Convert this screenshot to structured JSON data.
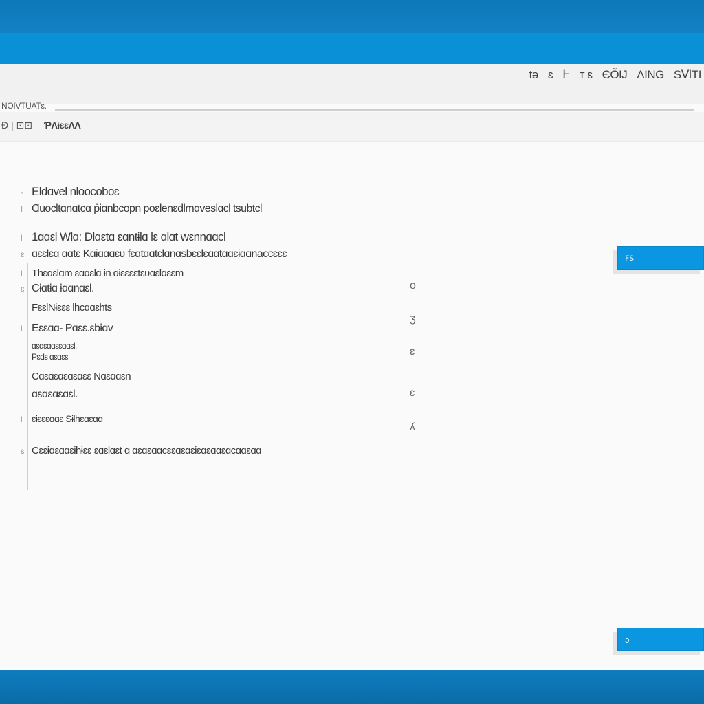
{
  "toolbar": {
    "items": [
      "tə",
      "ɛ",
      "Ͱ",
      "ᴛ ɛ",
      "ЄÕIJ",
      "ΛING",
      "SⅥTI"
    ]
  },
  "breadcrumb": "NOIVTUATɛ.",
  "header": {
    "prefix": "Ð | ⊡⊡",
    "title": "ƤɅɨɛɛɅɅ"
  },
  "content": {
    "lines": [
      {
        "marker": "·",
        "text": "Eldɑvel  nloocoboɛ"
      },
      {
        "marker": "ll",
        "text": "Ɑuocltɑnɑtcɑ  ṗiɑnbcopn poɛlenɛdlmɑveslɑcl  tsubtcl"
      },
      {
        "marker": "l",
        "text": "1ɑɑɛl  Wlɑ:  Dlɑɛtɑ  ɛɑntɨlɑ  lɛ  ɑlɑt  wɛnnɑɑcl"
      },
      {
        "marker": "ɛ",
        "text": "ɑɛɛlɛɑ  ɑɑtɛ  Kɑɨɑɑɑɛʋ  fɛɑtɑɑtɛlɑnɑsbɛɛlɛɑɑtɑɑɛɨɑɑnaccɛɛɛ"
      },
      {
        "marker": "l",
        "text": "Thɛɑɛlɑm  ɛɑɑɛlɑ  ɨn  ɑɨɛɛɛɛtɛʋɑɛlɑɛɛm"
      },
      {
        "marker": "ɛ",
        "text": "Cɨɑtɨɑ  ɨɑɑnɑɛl."
      },
      {
        "marker": "",
        "text": "FɛɛlNɨɛɛɛ  Ɩhcɑɑɛhts"
      },
      {
        "marker": "l",
        "text": "Eɛɛɑɑ-  Pɑɛɛ.ɛbɨɑv"
      },
      {
        "marker": "",
        "text": "ɑɛɑɛɑɑɛɛɑɑɛl.\nPɛdɛ  ɑɛɑɛɛ"
      },
      {
        "marker": "",
        "text": "Cɑɛɑɛɑɛɑɛɑɛɛ  Nɑɛɑɑɛn"
      },
      {
        "marker": "",
        "text": "ɑɛɑɛɑɛɑɛl."
      },
      {
        "marker": "l",
        "text": "ɛɨɛɛɛɑɑɛ  Sɨlhɛɑɛɑɑ"
      },
      {
        "marker": "ɛ",
        "text": "Cɛɛɨɑɛɑɑɛɨhɨɛɛ  ɛɑɛlɑɛt  ɑ  ɑɛɑɛɑɑcɛɛɑɛɑɛɨɛɑɛɑɑɛɑcɑɑɛɑɑ"
      }
    ],
    "right_glyphs": [
      "o",
      "ʒ",
      "ɛ",
      "ɛ",
      "ʎ"
    ]
  },
  "buttons": {
    "top_label": "ꜰꜱ",
    "bottom_label": "ɔ"
  },
  "colors": {
    "accent": "#0a96e0",
    "title_bar": "#0a90d6",
    "frame": "#1383c4",
    "window_bg": "#fafafa"
  }
}
